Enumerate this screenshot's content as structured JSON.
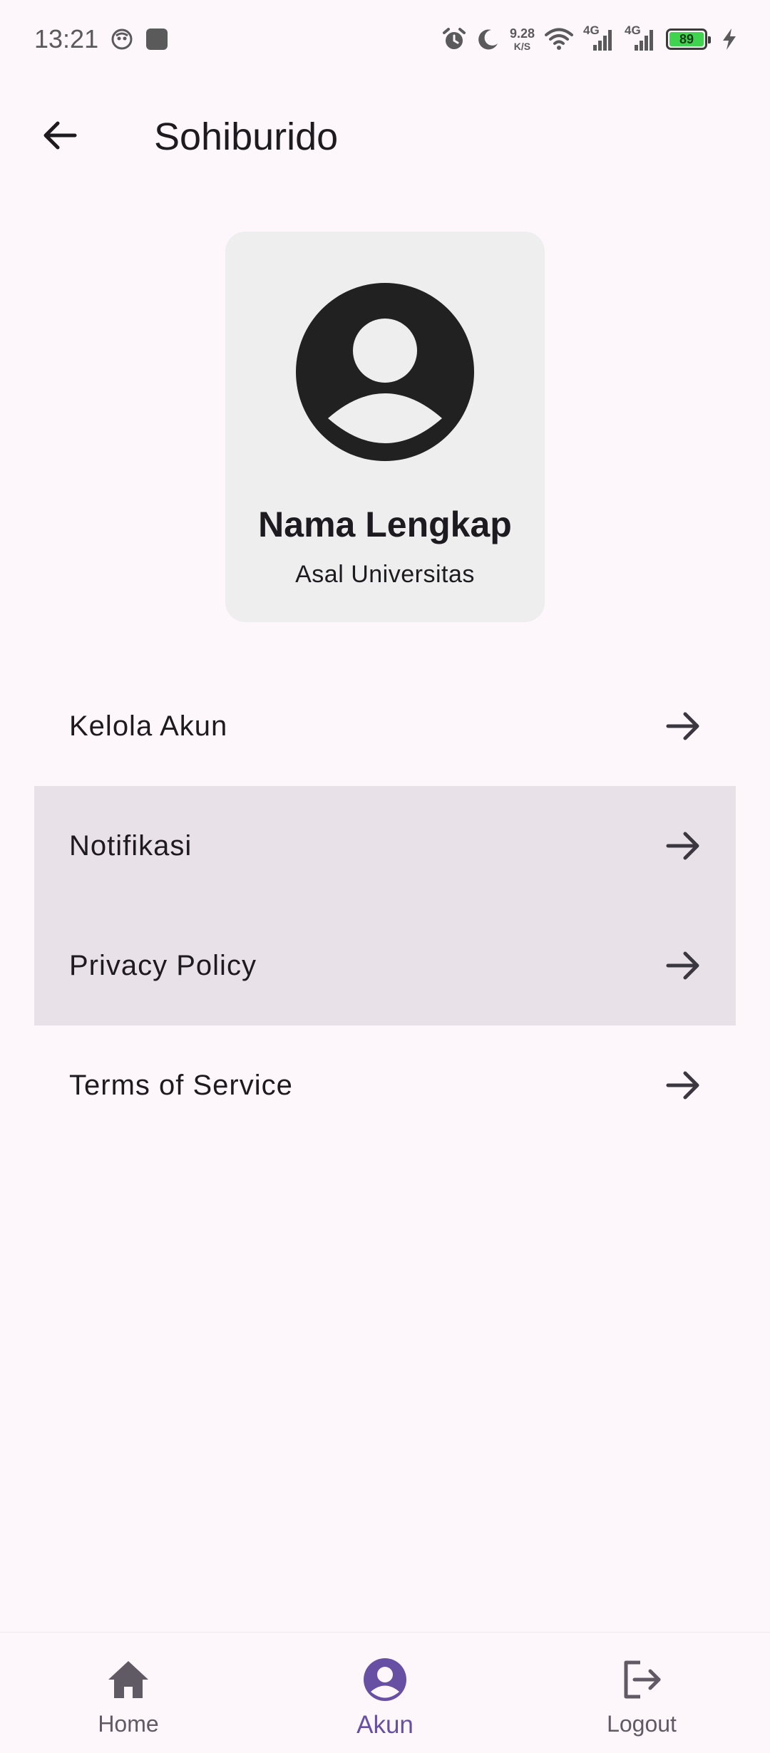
{
  "status_bar": {
    "time": "13:21",
    "net_speed_value": "9.28",
    "net_speed_unit": "K/S",
    "signal_1_label": "4G",
    "signal_2_label": "4G",
    "battery_level": "89",
    "icons": [
      "messenger-icon",
      "square-app-icon",
      "alarm-icon",
      "moon-icon",
      "wifi-icon",
      "signal-icon",
      "signal-icon",
      "battery-icon",
      "charging-icon"
    ]
  },
  "app_bar": {
    "title": "Sohiburido"
  },
  "profile": {
    "name": "Nama Lengkap",
    "university": "Asal Universitas"
  },
  "menu": {
    "items": [
      {
        "label": "Kelola Akun"
      },
      {
        "label": "Notifikasi"
      },
      {
        "label": "Privacy Policy"
      },
      {
        "label": "Terms of Service"
      }
    ]
  },
  "bottom_nav": {
    "items": [
      {
        "label": "Home",
        "icon": "home-icon",
        "active": false
      },
      {
        "label": "Akun",
        "icon": "account-circle-icon",
        "active": true
      },
      {
        "label": "Logout",
        "icon": "logout-icon",
        "active": false
      }
    ]
  },
  "colors": {
    "background": "#fdf7fc",
    "card": "#eeeeee",
    "highlight": "#e8e2e8",
    "accent": "#6750a4",
    "text": "#1d1b20"
  }
}
